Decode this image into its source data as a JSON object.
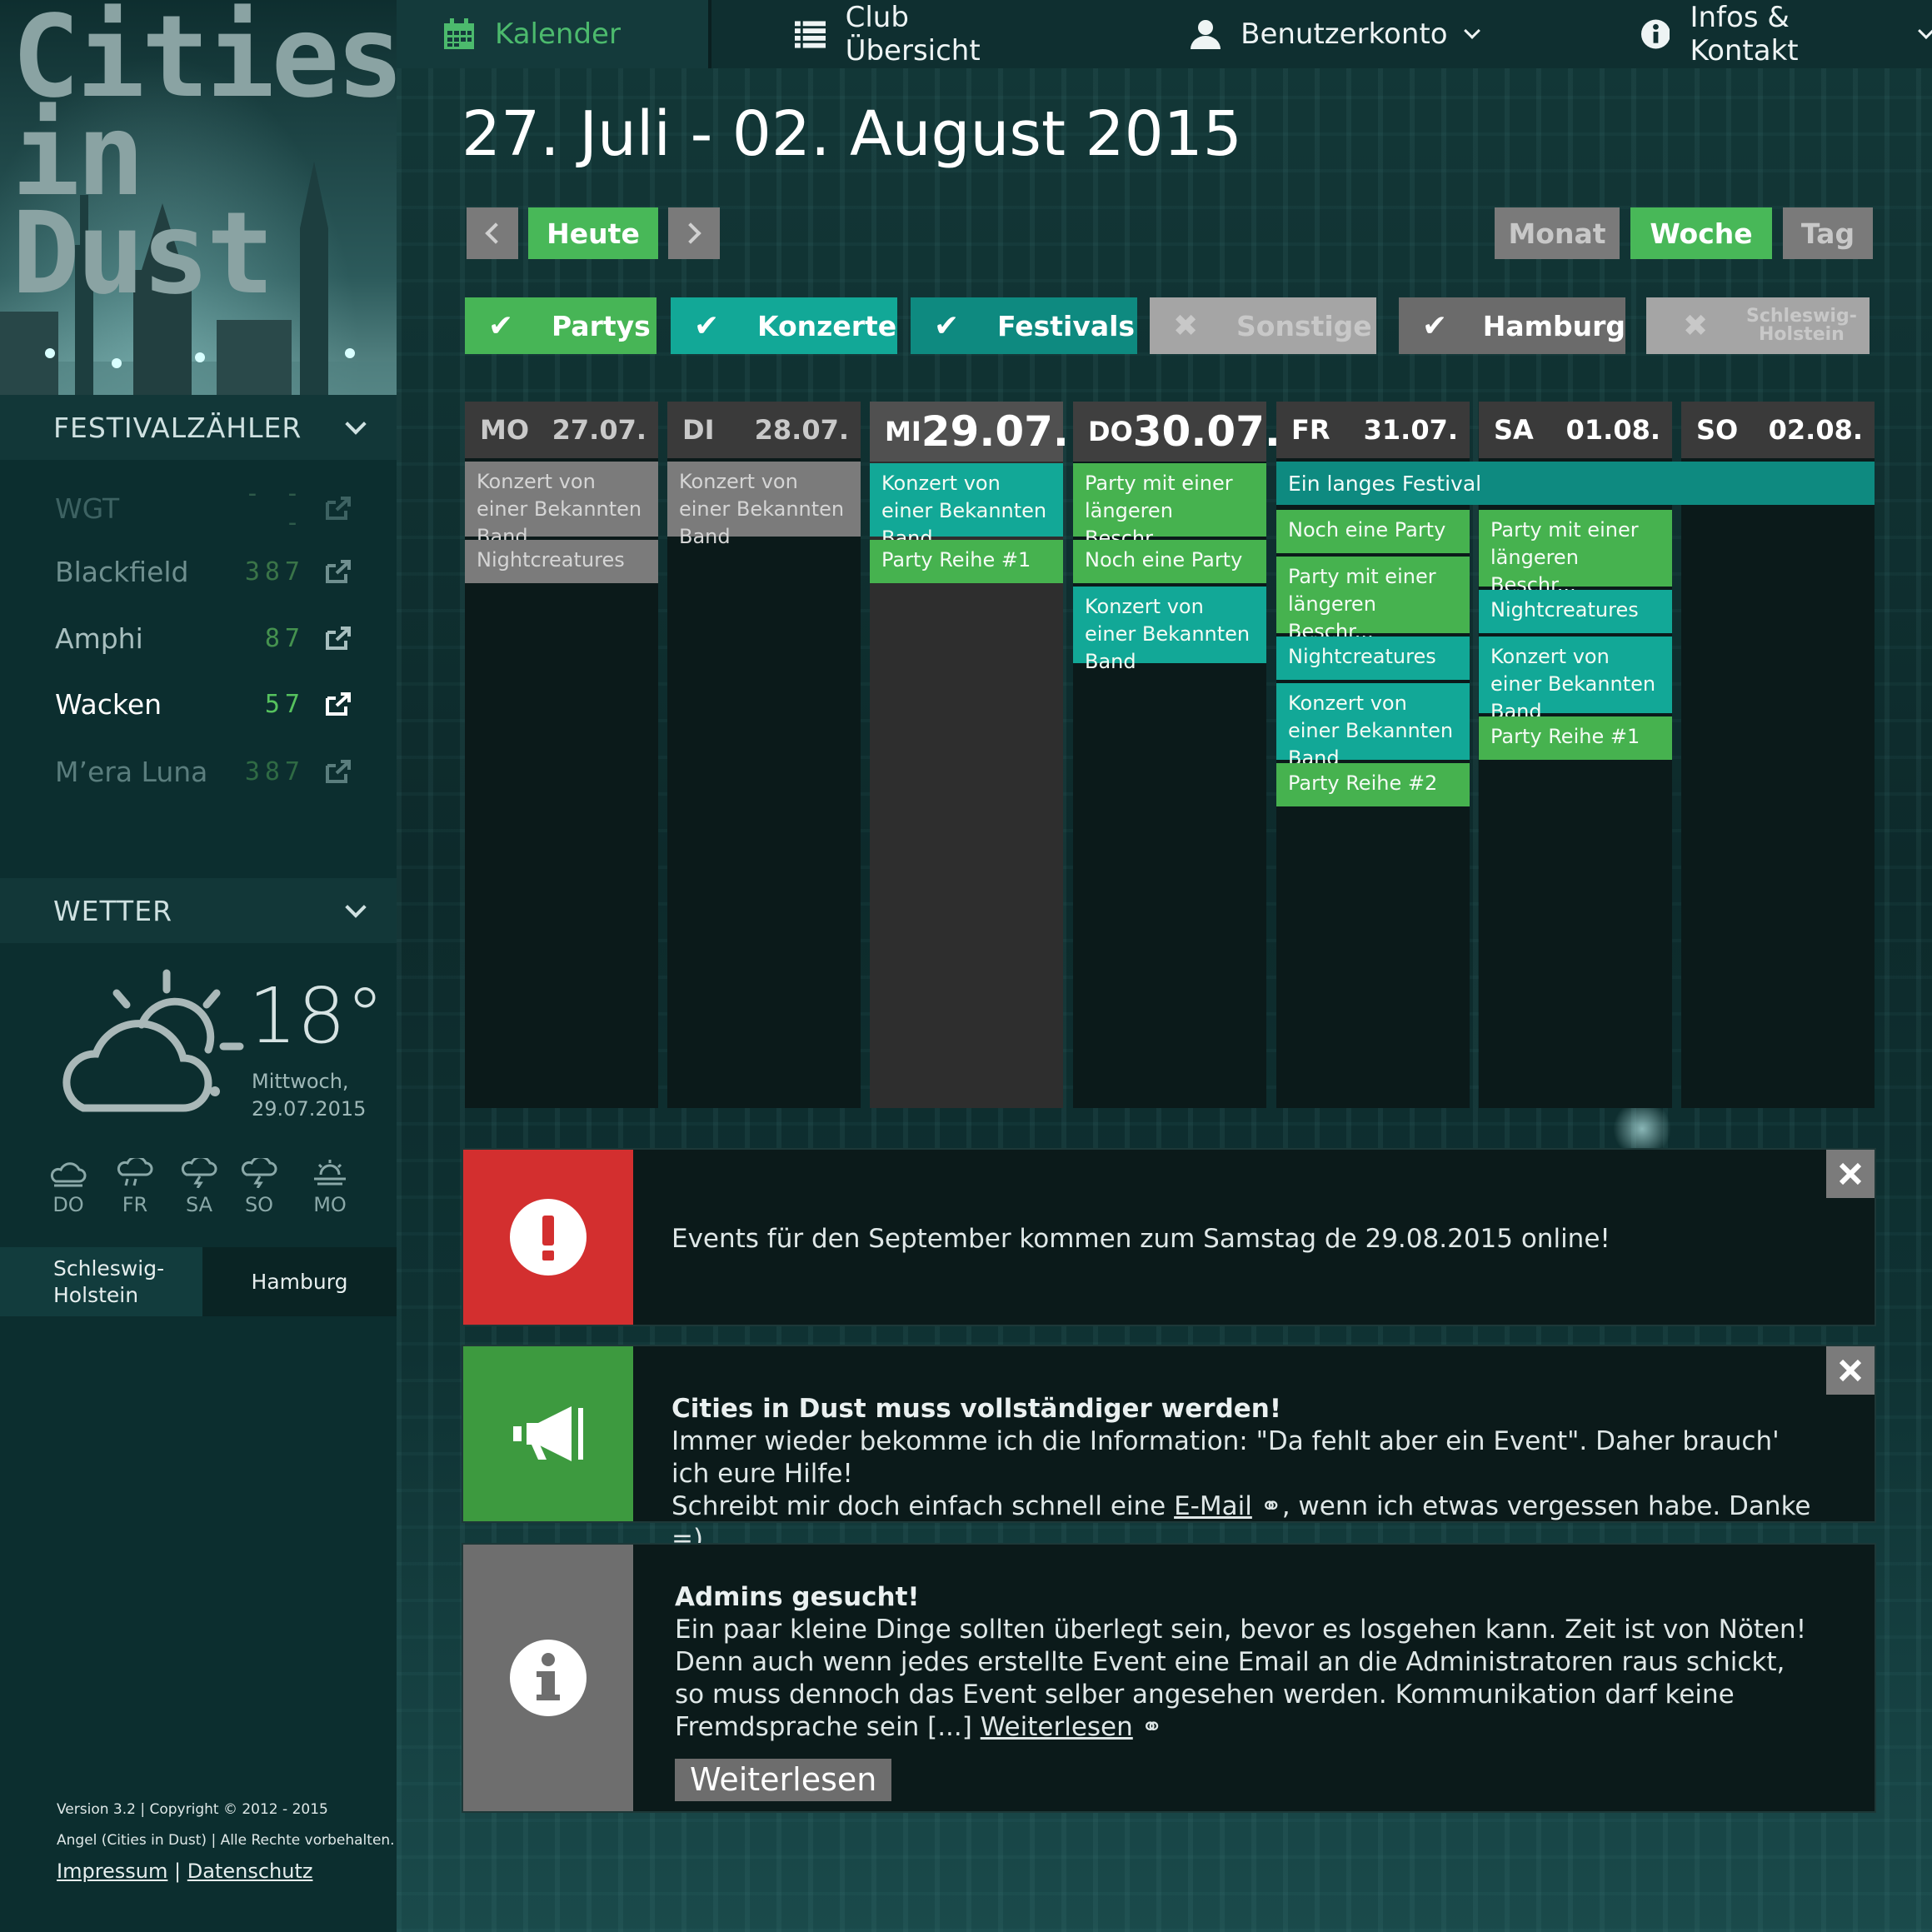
{
  "logo": {
    "line1": "Cities",
    "line2": "in Dust"
  },
  "nav": {
    "calendar": "Kalender",
    "clubs": "Club Übersicht",
    "account": "Benutzerkonto",
    "info": "Infos & Kontakt"
  },
  "sidebar": {
    "festival_header": "FESTIVALZÄHLER",
    "festivals": [
      {
        "name": "WGT",
        "count": "- - -"
      },
      {
        "name": "Blackfield",
        "count": "387"
      },
      {
        "name": "Amphi",
        "count": "87"
      },
      {
        "name": "Wacken",
        "count": "57"
      },
      {
        "name": "M’era Luna",
        "count": "387"
      }
    ],
    "weather_header": "WETTER",
    "weather": {
      "temperature": "18°",
      "weekday": "Mittwoch,",
      "date": "29.07.2015",
      "forecast": [
        "DO",
        "FR",
        "SA",
        "SO",
        "MO"
      ]
    },
    "regions": {
      "first": "Schleswig-\nHolstein",
      "second": "Hamburg"
    },
    "footer": {
      "version": "Version 3.2 | Copyright © 2012 - 2015",
      "rights": "Angel (Cities in Dust) | Alle Rechte vorbehalten.",
      "impressum": "Impressum",
      "separator": "|",
      "privacy": "Datenschutz"
    }
  },
  "calendar": {
    "title": "27. Juli - 02. August 2015",
    "today_label": "Heute",
    "views": {
      "month": "Monat",
      "week": "Woche",
      "day": "Tag"
    },
    "filters": {
      "partys": "Partys",
      "konzerte": "Konzerte",
      "festivals": "Festivals",
      "sonstige": "Sonstige",
      "hamburg": "Hamburg",
      "sh": "Schleswig-\nHolstein"
    },
    "days": [
      {
        "name": "MO",
        "date": "27.07."
      },
      {
        "name": "DI",
        "date": "28.07."
      },
      {
        "name": "MI",
        "date": "29.07."
      },
      {
        "name": "DO",
        "date": "30.07."
      },
      {
        "name": "FR",
        "date": "31.07."
      },
      {
        "name": "SA",
        "date": "01.08."
      },
      {
        "name": "SO",
        "date": "02.08."
      }
    ],
    "festival_event": "Ein langes Festival",
    "events": {
      "mo1": "Konzert von einer Bekannten Band",
      "mo2": "Nightcreatures",
      "di1": "Konzert von einer Bekannten Band",
      "mi1": "Konzert von einer Bekannten Band",
      "mi2": "Party Reihe #1",
      "do1": "Party mit einer längeren Beschr...",
      "do2": "Noch eine Party",
      "do3": "Konzert von einer Bekannten Band",
      "fr1": "Noch eine Party",
      "fr2": "Party mit einer längeren Beschr...",
      "fr3": "Nightcreatures",
      "fr4": "Konzert von einer Bekannten Band",
      "fr5": "Party Reihe #2",
      "sa1": "Party mit einer längeren Beschr...",
      "sa2": "Nightcreatures",
      "sa3": "Konzert von einer Bekannten Band",
      "sa4": "Party Reihe #1"
    }
  },
  "notices": {
    "alert": "Events für den September kommen zum Samstag de 29.08.2015 online!",
    "help": {
      "title": "Cities in Dust muss vollständiger werden!",
      "line1": "Immer wieder bekomme ich die Information: \"Da fehlt aber ein Event\". Daher brauch' ich eure Hilfe!",
      "pre": "Schreibt mir doch einfach schnell eine ",
      "link": "E-Mail",
      "post": ", wenn ich etwas vergessen habe. Danke =)"
    },
    "admins": {
      "title": "Admins gesucht!",
      "body": "Ein paar kleine Dinge sollten überlegt sein, bevor es losgehen kann. Zeit ist von Nöten! Denn auch wenn jedes erstellte Event eine Email an die Administratoren raus schickt, so muss dennoch das Event selber angesehen werden. Kommunikation darf keine Fremdsprache sein [...] ",
      "link": "Weiterlesen",
      "button": "Weiterlesen"
    }
  },
  "colors": {
    "accent_green": "#48b858",
    "teal": "#12a897",
    "alert_red": "#d32f2f",
    "notice_green": "#3d9a3f",
    "neutral_gray": "#7b7b7b"
  }
}
